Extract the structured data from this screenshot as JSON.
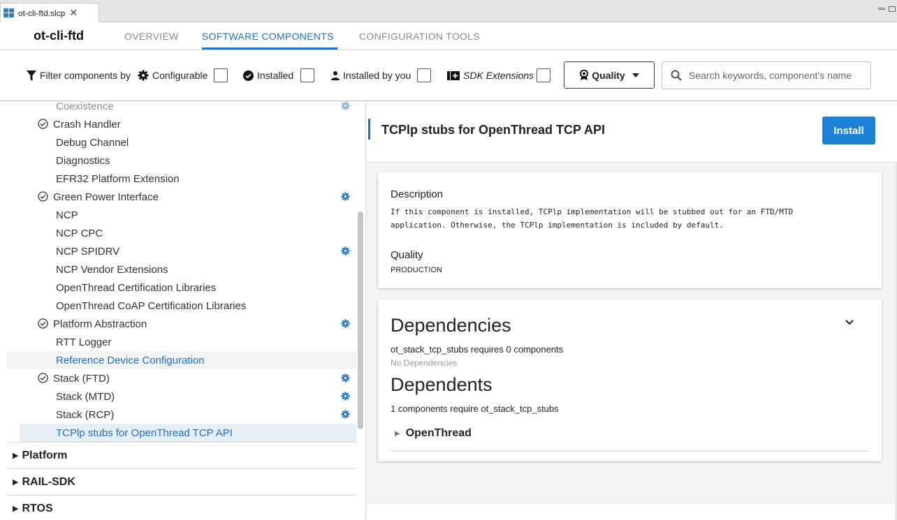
{
  "editor_tab": {
    "label": "ot-cli-ftd.slcp",
    "close": "✕"
  },
  "header": {
    "title": "ot-cli-ftd",
    "tabs": [
      {
        "label": "OVERVIEW",
        "active": false
      },
      {
        "label": "SOFTWARE COMPONENTS",
        "active": true
      },
      {
        "label": "CONFIGURATION TOOLS",
        "active": false
      }
    ]
  },
  "filters": {
    "label": "Filter components by",
    "configurable": "Configurable",
    "installed": "Installed",
    "installed_by_you": "Installed by you",
    "sdk_extensions": "SDK Extensions",
    "quality": "Quality",
    "search_placeholder": "Search keywords, component's name"
  },
  "tree": {
    "items": [
      {
        "label": "Coexistence",
        "installed": false,
        "configurable": true
      },
      {
        "label": "Crash Handler",
        "installed": true,
        "configurable": false
      },
      {
        "label": "Debug Channel",
        "installed": false,
        "configurable": false
      },
      {
        "label": "Diagnostics",
        "installed": false,
        "configurable": false
      },
      {
        "label": "EFR32 Platform Extension",
        "installed": false,
        "configurable": false
      },
      {
        "label": "Green Power Interface",
        "installed": true,
        "configurable": true
      },
      {
        "label": "NCP",
        "installed": false,
        "configurable": false
      },
      {
        "label": "NCP CPC",
        "installed": false,
        "configurable": false
      },
      {
        "label": "NCP SPIDRV",
        "installed": false,
        "configurable": true
      },
      {
        "label": "NCP Vendor Extensions",
        "installed": false,
        "configurable": false
      },
      {
        "label": "OpenThread Certification Libraries",
        "installed": false,
        "configurable": false
      },
      {
        "label": "OpenThread CoAP Certification Libraries",
        "installed": false,
        "configurable": false
      },
      {
        "label": "Platform Abstraction",
        "installed": true,
        "configurable": true
      },
      {
        "label": "RTT Logger",
        "installed": false,
        "configurable": false
      },
      {
        "label": "Reference Device Configuration",
        "installed": false,
        "configurable": false
      },
      {
        "label": "Stack (FTD)",
        "installed": true,
        "configurable": true
      },
      {
        "label": "Stack (MTD)",
        "installed": false,
        "configurable": true
      },
      {
        "label": "Stack (RCP)",
        "installed": false,
        "configurable": true
      },
      {
        "label": "TCPlp stubs for OpenThread TCP API",
        "installed": false,
        "configurable": false
      }
    ],
    "categories": [
      "Platform",
      "RAIL-SDK",
      "RTOS"
    ]
  },
  "detail": {
    "title": "TCPlp stubs for OpenThread TCP API",
    "install_label": "Install",
    "description_heading": "Description",
    "description_line1": "If this component is installed, TCPlp implementation will be stubbed out for an FTD/MTD",
    "description_line2": "application. Otherwise, the TCPlp implementation is included by default.",
    "quality_heading": "Quality",
    "quality_value": "PRODUCTION",
    "dependencies_heading": "Dependencies",
    "dependencies_summary": "ot_stack_tcp_stubs requires 0 components",
    "no_dependencies": "No Dependencies",
    "dependents_heading": "Dependents",
    "dependents_summary": "1 components require ot_stack_tcp_stubs",
    "dependent_item": "OpenThread"
  },
  "colors": {
    "accent": "#1d6fcb",
    "install_button": "#1a80d8",
    "gear": "#2878c8"
  },
  "icons": [
    "app-logo-icon",
    "close-icon",
    "filter-icon",
    "gear-icon",
    "check-circle-icon",
    "person-icon",
    "extension-icon",
    "award-icon",
    "search-icon",
    "chevron-down-icon",
    "caret-right-icon"
  ]
}
